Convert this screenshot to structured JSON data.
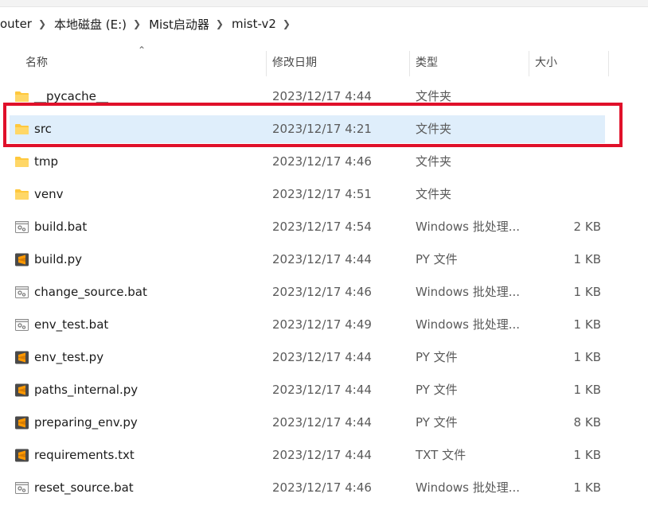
{
  "breadcrumb": [
    "outer",
    "本地磁盘 (E:)",
    "Mist启动器",
    "mist-v2"
  ],
  "columns": {
    "name": "名称",
    "modified": "修改日期",
    "type": "类型",
    "size": "大小"
  },
  "files": [
    {
      "name": "__pycache__",
      "modified": "2023/12/17 4:44",
      "type": "文件夹",
      "size": "",
      "icon": "folder-icon"
    },
    {
      "name": "src",
      "modified": "2023/12/17 4:21",
      "type": "文件夹",
      "size": "",
      "icon": "folder-icon",
      "selected": true
    },
    {
      "name": "tmp",
      "modified": "2023/12/17 4:46",
      "type": "文件夹",
      "size": "",
      "icon": "folder-icon"
    },
    {
      "name": "venv",
      "modified": "2023/12/17 4:51",
      "type": "文件夹",
      "size": "",
      "icon": "folder-icon"
    },
    {
      "name": "build.bat",
      "modified": "2023/12/17 4:54",
      "type": "Windows 批处理...",
      "size": "2 KB",
      "icon": "batch-file-icon"
    },
    {
      "name": "build.py",
      "modified": "2023/12/17 4:44",
      "type": "PY 文件",
      "size": "1 KB",
      "icon": "sublime-text-file-icon"
    },
    {
      "name": "change_source.bat",
      "modified": "2023/12/17 4:46",
      "type": "Windows 批处理...",
      "size": "1 KB",
      "icon": "batch-file-icon"
    },
    {
      "name": "env_test.bat",
      "modified": "2023/12/17 4:49",
      "type": "Windows 批处理...",
      "size": "1 KB",
      "icon": "batch-file-icon"
    },
    {
      "name": "env_test.py",
      "modified": "2023/12/17 4:44",
      "type": "PY 文件",
      "size": "1 KB",
      "icon": "sublime-text-file-icon"
    },
    {
      "name": "paths_internal.py",
      "modified": "2023/12/17 4:44",
      "type": "PY 文件",
      "size": "1 KB",
      "icon": "sublime-text-file-icon"
    },
    {
      "name": "preparing_env.py",
      "modified": "2023/12/17 4:44",
      "type": "PY 文件",
      "size": "8 KB",
      "icon": "sublime-text-file-icon"
    },
    {
      "name": "requirements.txt",
      "modified": "2023/12/17 4:44",
      "type": "TXT 文件",
      "size": "1 KB",
      "icon": "sublime-text-file-icon"
    },
    {
      "name": "reset_source.bat",
      "modified": "2023/12/17 4:46",
      "type": "Windows 批处理...",
      "size": "1 KB",
      "icon": "batch-file-icon"
    }
  ],
  "colors": {
    "selection": "#dfeefb",
    "highlight_box": "#e0102a",
    "folder": "#ffc83d",
    "sublime": "#ff9800"
  }
}
